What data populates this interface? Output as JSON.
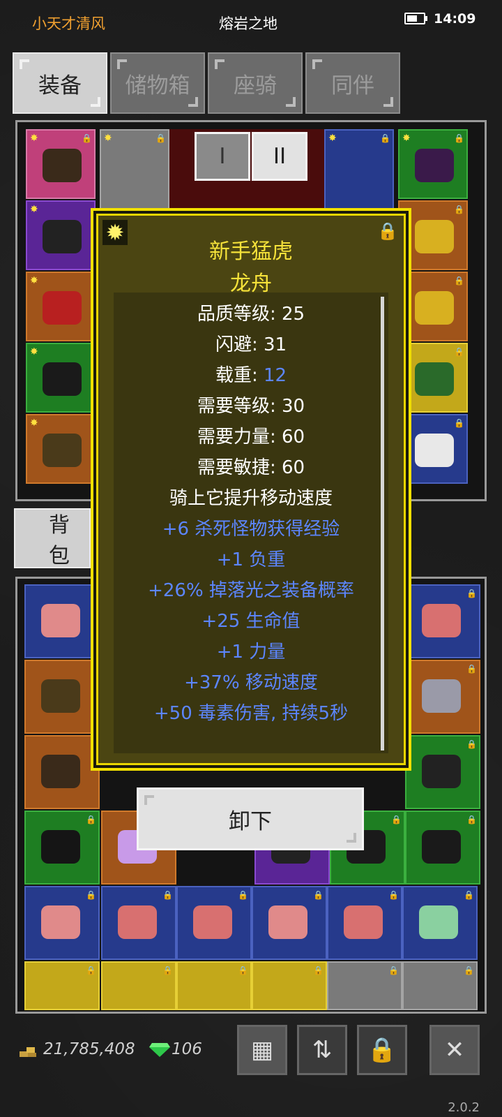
{
  "status": {
    "player_name": "小天才清风",
    "location": "熔岩之地",
    "time": "14:09"
  },
  "tabs": [
    {
      "label": "装备",
      "active": true
    },
    {
      "label": "储物箱",
      "active": false
    },
    {
      "label": "座骑",
      "active": false
    },
    {
      "label": "同伴",
      "active": false
    }
  ],
  "pager": {
    "page1": "I",
    "page2": "II"
  },
  "bag_tab": {
    "label": "背包"
  },
  "tooltip": {
    "item_name": "新手猛虎",
    "item_type": "龙舟",
    "stats": [
      {
        "label": "品质等级: 25",
        "color": "white"
      },
      {
        "label": "闪避: 31",
        "color": "white"
      },
      {
        "label": "载重: ",
        "value": "12",
        "color": "white"
      },
      {
        "label": "需要等级: 30",
        "color": "white"
      },
      {
        "label": "需要力量: 60",
        "color": "white"
      },
      {
        "label": "需要敏捷: 60",
        "color": "white"
      },
      {
        "label": "骑上它提升移动速度",
        "color": "white"
      },
      {
        "label": "+6 杀死怪物获得经验",
        "color": "blue"
      },
      {
        "label": "+1 负重",
        "color": "blue"
      },
      {
        "label": "+26% 掉落光之装备概率",
        "color": "blue"
      },
      {
        "label": "+25 生命值",
        "color": "blue"
      },
      {
        "label": "+1 力量",
        "color": "blue"
      },
      {
        "label": "+37% 移动速度",
        "color": "blue"
      },
      {
        "label": "+50 毒素伤害, 持续5秒",
        "color": "blue"
      }
    ],
    "action_button": "卸下"
  },
  "footer": {
    "gold": "21,785,408",
    "gems": "106",
    "version": "2.0.2"
  },
  "colors": {
    "tooltip_border": "#f2e000",
    "tooltip_title": "#f6e23a",
    "magic_stat": "#5c86ff"
  }
}
